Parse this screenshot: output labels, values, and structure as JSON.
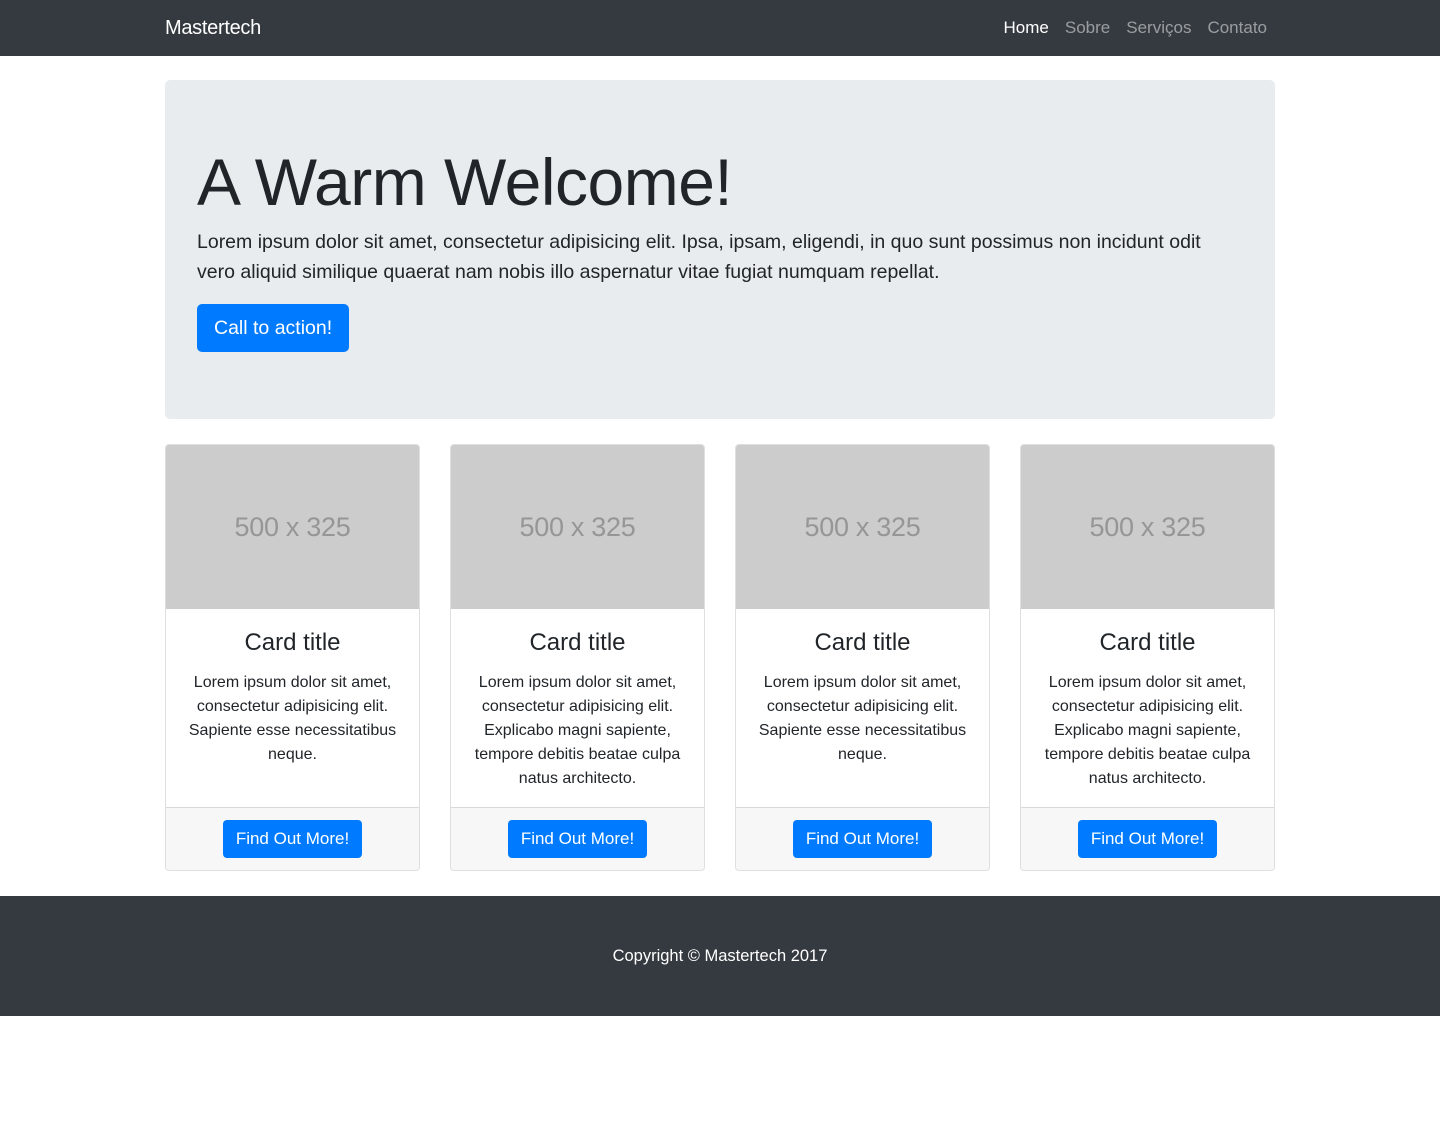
{
  "navbar": {
    "brand": "Mastertech",
    "links": [
      {
        "label": "Home",
        "active": true
      },
      {
        "label": "Sobre"
      },
      {
        "label": "Serviços"
      },
      {
        "label": "Contato"
      }
    ]
  },
  "jumbotron": {
    "heading": "A Warm Welcome!",
    "lead": "Lorem ipsum dolor sit amet, consectetur adipisicing elit. Ipsa, ipsam, eligendi, in quo sunt possimus non incidunt odit vero aliquid similique quaerat nam nobis illo aspernatur vitae fugiat numquam repellat.",
    "cta_label": "Call to action!"
  },
  "cards": [
    {
      "image_label": "500 x 325",
      "title": "Card title",
      "text": "Lorem ipsum dolor sit amet, consectetur adipisicing elit. Sapiente esse necessitatibus neque.",
      "button": "Find Out More!"
    },
    {
      "image_label": "500 x 325",
      "title": "Card title",
      "text": "Lorem ipsum dolor sit amet, consectetur adipisicing elit. Explicabo magni sapiente, tempore debitis beatae culpa natus architecto.",
      "button": "Find Out More!"
    },
    {
      "image_label": "500 x 325",
      "title": "Card title",
      "text": "Lorem ipsum dolor sit amet, consectetur adipisicing elit. Sapiente esse necessitatibus neque.",
      "button": "Find Out More!"
    },
    {
      "image_label": "500 x 325",
      "title": "Card title",
      "text": "Lorem ipsum dolor sit amet, consectetur adipisicing elit. Explicabo magni sapiente, tempore debitis beatae culpa natus architecto.",
      "button": "Find Out More!"
    }
  ],
  "footer": {
    "copyright": "Copyright © Mastertech 2017"
  },
  "colors": {
    "navbar_bg": "#343a40",
    "jumbotron_bg": "#e9ecef",
    "primary": "#007bff",
    "placeholder_bg": "#cccccc"
  }
}
